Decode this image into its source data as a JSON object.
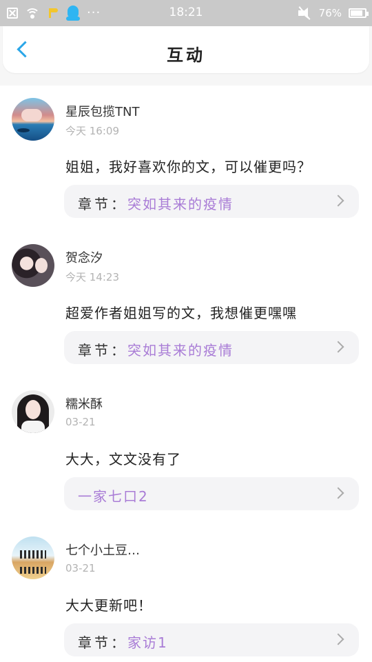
{
  "status_bar": {
    "time": "18:21",
    "battery_percent": "76%",
    "battery_level": 0.76,
    "dots": "···",
    "icons": [
      "close-box-icon",
      "wifi-icon",
      "flag-icon",
      "qq-icon",
      "more-dots-icon",
      "mute-icon",
      "battery-icon"
    ]
  },
  "header": {
    "title": "互动",
    "back_icon": "chevron-left-icon"
  },
  "colors": {
    "accent_blue": "#2aa6e8",
    "chapter_purple": "#a97cd6",
    "time_gray": "#b3b3b3",
    "chapter_bg": "#f4f4f6"
  },
  "comments": [
    {
      "user": "星辰包揽TNT",
      "time": "今天 16:09",
      "content": "姐姐，我好喜欢你的文，可以催更吗？",
      "chapter_label": "章节：",
      "chapter_title": "突如其来的疫情"
    },
    {
      "user": "贺念汐",
      "time": "今天 14:23",
      "content": "超爱作者姐姐写的文，我想催更嘿嘿",
      "chapter_label": "章节：",
      "chapter_title": "突如其来的疫情"
    },
    {
      "user": "糯米酥",
      "time": "03-21",
      "content": "大大，文文没有了",
      "chapter_label": "",
      "chapter_title": "一家七口2"
    },
    {
      "user": "七个小土豆…",
      "time": "03-21",
      "content": "大大更新吧！",
      "chapter_label": "章节：",
      "chapter_title": "家访1"
    }
  ]
}
